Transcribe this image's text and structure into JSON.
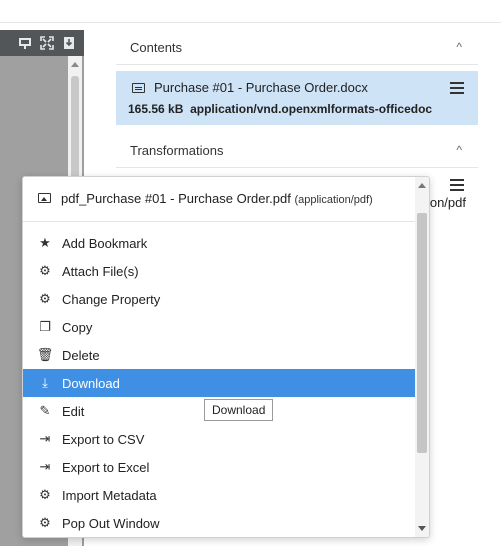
{
  "viewer": {
    "toolbar_icons": [
      "presentation-icon",
      "fullscreen-icon",
      "download-doc-icon"
    ]
  },
  "panel": {
    "contents_title": "Contents",
    "contents_chevron": "^",
    "file": {
      "name": "Purchase #01 - Purchase Order.docx",
      "size": "165.56 kB",
      "mime": "application/vnd.openxmlformats-officedoc"
    },
    "transformations_title": "Transformations",
    "transformations_chevron": "^",
    "behind_text": "on/pdf"
  },
  "menu": {
    "file_name": "pdf_Purchase #01 - Purchase Order.pdf",
    "file_mime": "(application/pdf)",
    "items": [
      {
        "label": "Add Bookmark",
        "icon": "star-icon",
        "glyph": "★"
      },
      {
        "label": "Attach File(s)",
        "icon": "cogs-icon",
        "glyph": "⚙"
      },
      {
        "label": "Change Property",
        "icon": "cogs-icon",
        "glyph": "⚙"
      },
      {
        "label": "Copy",
        "icon": "copy-icon",
        "glyph": "❐"
      },
      {
        "label": "Delete",
        "icon": "trash-icon",
        "glyph": "🗑"
      },
      {
        "label": "Download",
        "icon": "download-icon",
        "glyph": "⤓"
      },
      {
        "label": "Edit",
        "icon": "pencil-icon",
        "glyph": "✎"
      },
      {
        "label": "Export to CSV",
        "icon": "export-icon",
        "glyph": "⇥"
      },
      {
        "label": "Export to Excel",
        "icon": "export-icon",
        "glyph": "⇥"
      },
      {
        "label": "Import Metadata",
        "icon": "cogs-icon",
        "glyph": "⚙"
      },
      {
        "label": "Pop Out Window",
        "icon": "cogs-icon",
        "glyph": "⚙"
      }
    ],
    "active_item": "Download"
  },
  "tooltip": {
    "text": "Download"
  },
  "colors": {
    "active": "#3f8fe5",
    "selected_card": "#cfe3f7",
    "viewer_toolbar": "#525659"
  }
}
